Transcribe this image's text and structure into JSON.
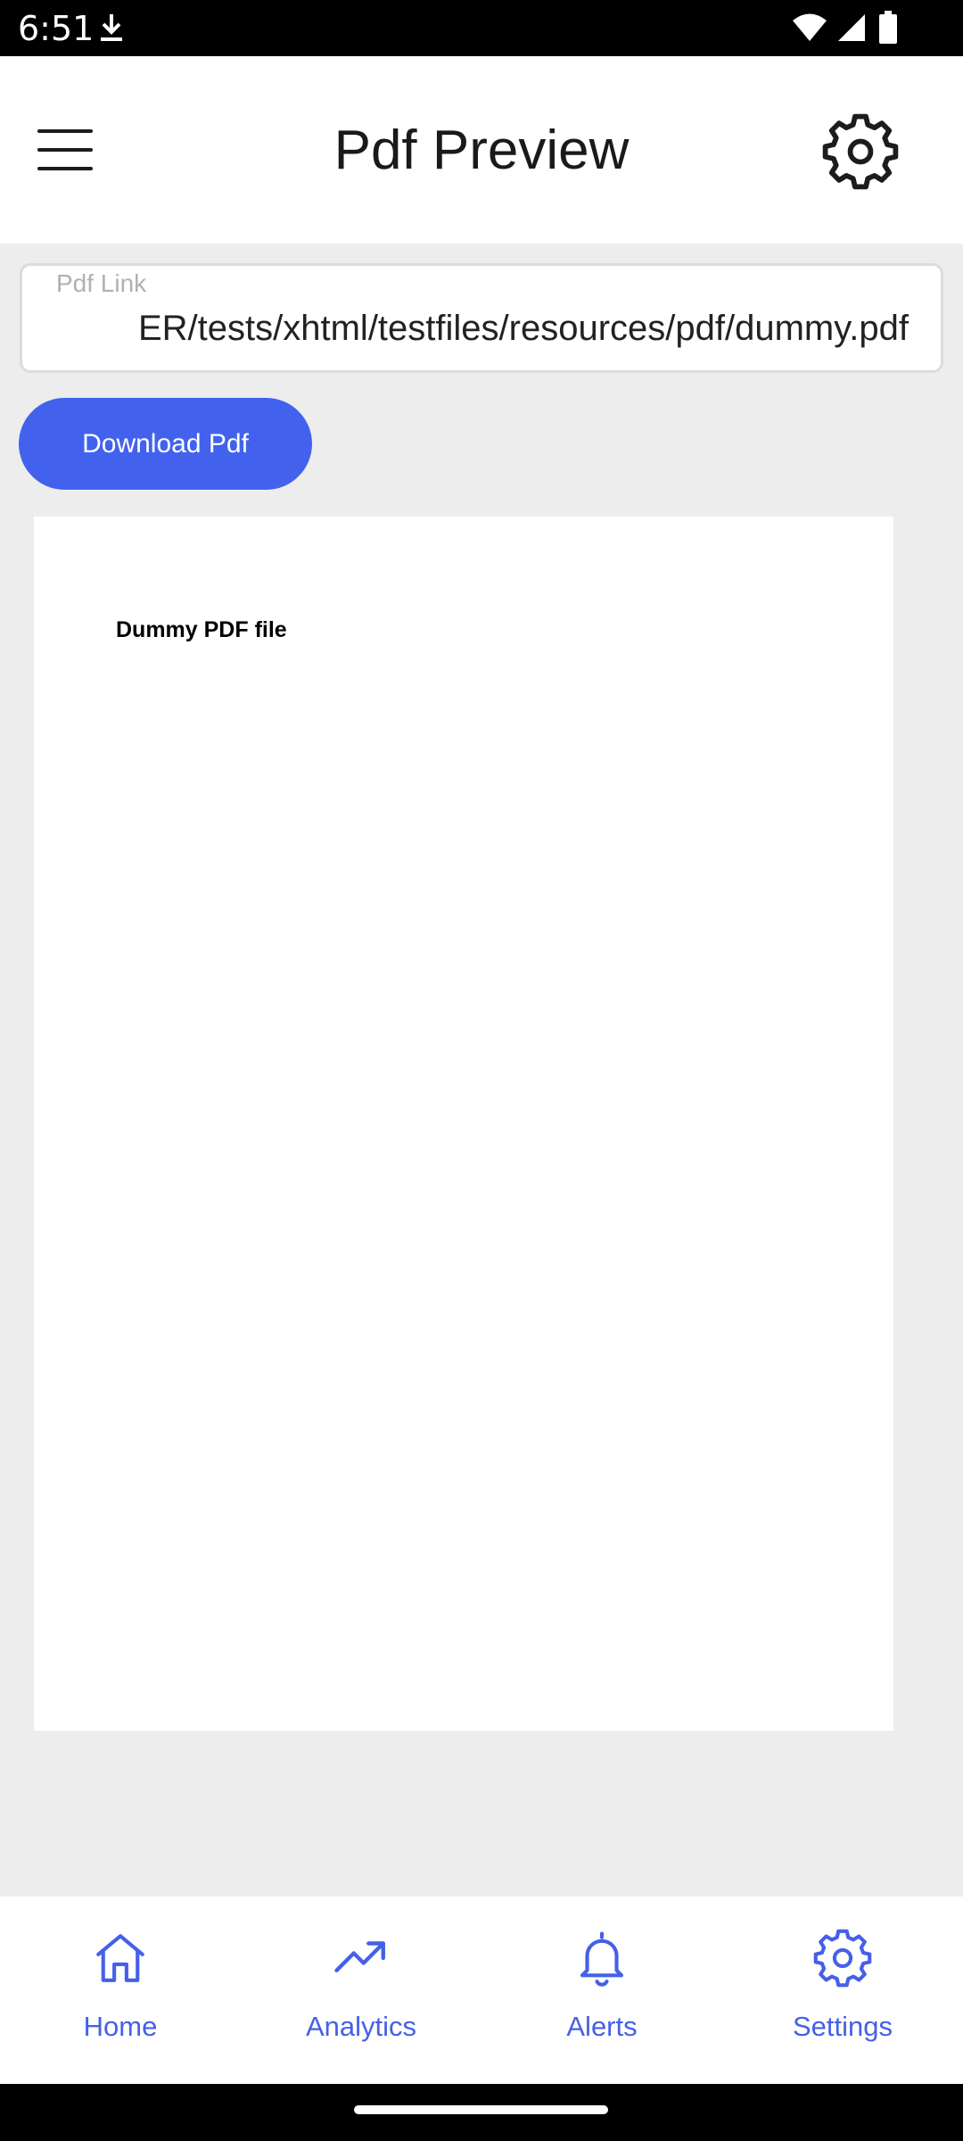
{
  "status_bar": {
    "time": "6:51",
    "icons": [
      "download-icon",
      "wifi-icon",
      "signal-icon",
      "battery-icon"
    ]
  },
  "app_bar": {
    "title": "Pdf Preview",
    "menu_icon": "hamburger-menu-icon",
    "settings_icon": "gear-icon"
  },
  "pdf_field": {
    "label": "Pdf Link",
    "value": "ER/tests/xhtml/testfiles/resources/pdf/dummy.pdf"
  },
  "download_button": {
    "label": "Download Pdf"
  },
  "pdf_preview": {
    "heading": "Dummy PDF file"
  },
  "bottom_nav": {
    "items": [
      {
        "label": "Home",
        "icon": "home-icon"
      },
      {
        "label": "Analytics",
        "icon": "trending-up-icon"
      },
      {
        "label": "Alerts",
        "icon": "bell-icon"
      },
      {
        "label": "Settings",
        "icon": "gear-icon"
      }
    ]
  },
  "colors": {
    "accent": "#4262ee",
    "nav_accent": "#4560e8",
    "background": "#ededed"
  }
}
